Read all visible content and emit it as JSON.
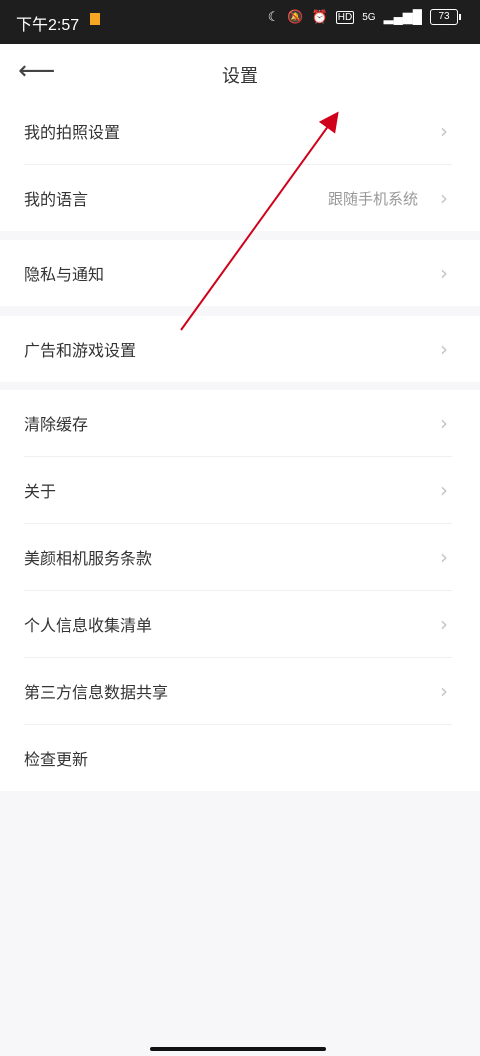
{
  "status": {
    "time": "下午2:57",
    "network": "5G",
    "battery": "73"
  },
  "header": {
    "title": "设置"
  },
  "groups": [
    {
      "items": [
        {
          "label": "我的拍照设置"
        },
        {
          "label": "我的语言",
          "value": "跟随手机系统"
        }
      ]
    },
    {
      "items": [
        {
          "label": "隐私与通知"
        }
      ]
    },
    {
      "items": [
        {
          "label": "广告和游戏设置"
        }
      ]
    },
    {
      "items": [
        {
          "label": "清除缓存"
        },
        {
          "label": "关于"
        },
        {
          "label": "美颜相机服务条款"
        },
        {
          "label": "个人信息收集清单"
        },
        {
          "label": "第三方信息数据共享"
        },
        {
          "label": "检查更新"
        }
      ]
    }
  ],
  "colors": {
    "annotation_arrow": "#d0021b"
  }
}
